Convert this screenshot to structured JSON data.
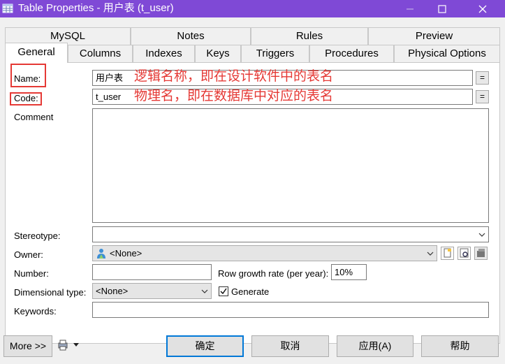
{
  "window": {
    "title": "Table Properties - 用户表 (t_user)"
  },
  "tabs": {
    "back_row": [
      "MySQL",
      "Notes",
      "Rules",
      "Preview"
    ],
    "front_row": [
      "General",
      "Columns",
      "Indexes",
      "Keys",
      "Triggers",
      "Procedures",
      "Physical Options"
    ],
    "active": "General"
  },
  "form": {
    "name_label": "Name:",
    "name_value": "用户表",
    "name_annotation": "逻辑名称，即在设计软件中的表名",
    "code_label": "Code:",
    "code_value": "t_user",
    "code_annotation": "物理名，即在数据库中对应的表名",
    "eq_button": "=",
    "comment_label": "Comment",
    "stereotype_label": "Stereotype:",
    "stereotype_value": "",
    "owner_label": "Owner:",
    "owner_value": "<None>",
    "number_label": "Number:",
    "number_value": "",
    "row_growth_label": "Row growth rate (per year):",
    "row_growth_value": "10%",
    "dimensional_type_label": "Dimensional type:",
    "dimensional_type_value": "<None>",
    "generate_label": "Generate",
    "generate_checked": true,
    "keywords_label": "Keywords:",
    "keywords_value": ""
  },
  "buttons": {
    "more": "More >>",
    "ok": "确定",
    "cancel": "取消",
    "apply": "应用(A)",
    "help": "帮助"
  },
  "colors": {
    "titlebar": "#7f49d6",
    "annotation": "#e53935",
    "default_button_border": "#0078d7"
  }
}
